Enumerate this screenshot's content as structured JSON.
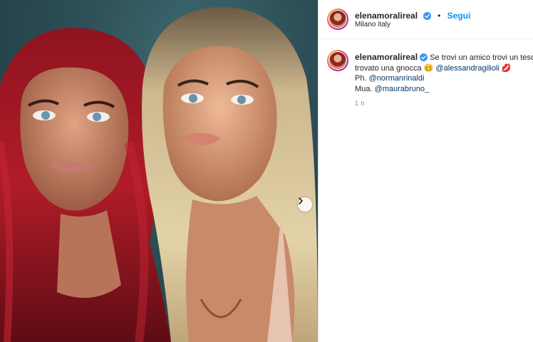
{
  "post": {
    "username": "elenamoralireal",
    "follow_label": "Segui",
    "separator": "•",
    "location": "Milano italy"
  },
  "caption": {
    "username": "elenamoralireal",
    "line1_text": "Se trovi un amico trovi un tesoro",
    "line2_text": "trovato una gnocca",
    "line2_emoji": "🥴",
    "line2_mention": "@alessandragilioli",
    "line2_emoji2": "💋",
    "line3_prefix": "Ph.",
    "line3_mention": "@normanrinaldi",
    "line4_prefix": "Mua.",
    "line4_mention": "@maurabruno_"
  },
  "timestamp": "1 h",
  "icons": {
    "verified": "verified-badge-icon",
    "next": "chevron-right-icon"
  },
  "colors": {
    "accent": "#0095f6",
    "verified": "#3897f0",
    "mention": "#00376b",
    "muted": "#8e8e8e"
  }
}
